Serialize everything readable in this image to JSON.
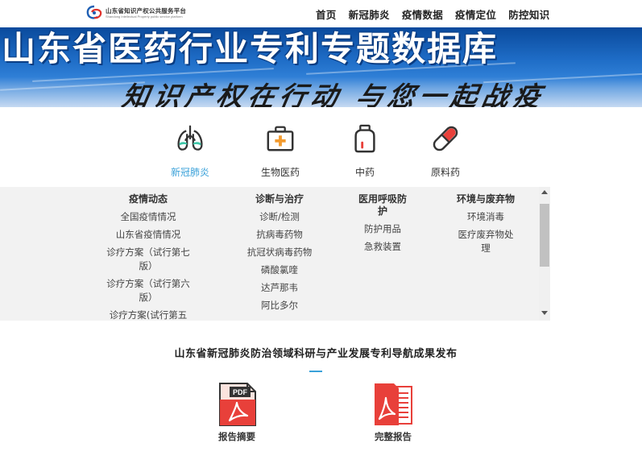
{
  "logo": {
    "name_cn": "山东省知识产权公共服务平台",
    "name_en": "Shandong Intellectual Property public service platform"
  },
  "nav": {
    "items": [
      {
        "label": "首页"
      },
      {
        "label": "新冠肺炎"
      },
      {
        "label": "疫情数据"
      },
      {
        "label": "疫情定位"
      },
      {
        "label": "防控知识"
      }
    ]
  },
  "banner": {
    "title": "山东省医药行业专利专题数据库",
    "slogan": "知识产权在行动 与您一起战疫"
  },
  "categories": {
    "active": "新冠肺炎",
    "items": [
      {
        "label": "新冠肺炎",
        "icon": "lungs-icon"
      },
      {
        "label": "生物医药",
        "icon": "medical-kit-icon"
      },
      {
        "label": "中药",
        "icon": "medicine-bottle-icon"
      },
      {
        "label": "原料药",
        "icon": "capsule-icon"
      }
    ]
  },
  "panel": {
    "columns": [
      {
        "heading": "疫情动态",
        "items": [
          "全国疫情情况",
          "山东省疫情情况",
          "诊疗方案（试行第七版）",
          "诊疗方案（试行第六版）",
          "诊疗方案(试行第五"
        ]
      },
      {
        "heading": "诊断与治疗",
        "items": [
          "诊断/检测",
          "抗病毒药物",
          "抗冠状病毒药物",
          "磷酸氯喹",
          "达芦那韦",
          "阿比多尔"
        ]
      },
      {
        "heading": "医用呼吸防护",
        "items": [
          "防护用品",
          "急救装置"
        ]
      },
      {
        "heading": "环境与废弃物",
        "items": [
          "环境消毒",
          "医疗废弃物处理"
        ]
      }
    ]
  },
  "release": {
    "title": "山东省新冠肺炎防治领域科研与产业发展专利导航成果发布",
    "docs": [
      {
        "label": "报告摘要",
        "badge": "PDF"
      },
      {
        "label": "完整报告"
      }
    ]
  },
  "colors": {
    "accent": "#3aa1d9",
    "pdf_red": "#e8403a",
    "banner_blue": "#1e6cc6"
  }
}
